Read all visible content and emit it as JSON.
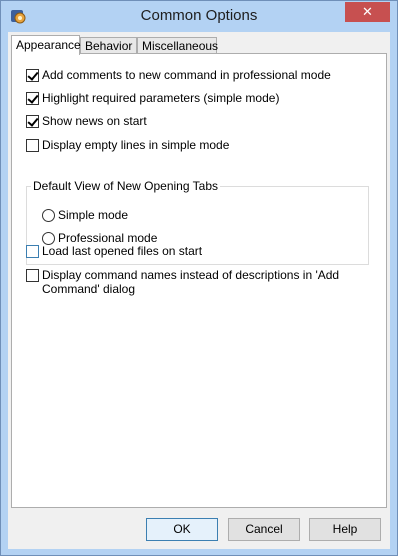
{
  "window": {
    "title": "Common Options",
    "close_glyph": "✕"
  },
  "tabs": [
    {
      "label": "Appearance",
      "active": true
    },
    {
      "label": "Behavior",
      "active": false
    },
    {
      "label": "Miscellaneous",
      "active": false
    }
  ],
  "options": {
    "add_comments": {
      "label": "Add comments to new command in professional mode",
      "checked": true
    },
    "highlight_required": {
      "label": "Highlight required parameters (simple mode)",
      "checked": true
    },
    "show_news": {
      "label": "Show news on start",
      "checked": true
    },
    "display_empty_lines": {
      "label": "Display empty lines in simple mode",
      "checked": false
    },
    "load_last_files": {
      "label": "Load last opened files on start",
      "checked": false
    },
    "display_command_names": {
      "label": "Display command names instead of descriptions in 'Add Command' dialog",
      "checked": false
    }
  },
  "default_view": {
    "label": "Default View of  New Opening Tabs",
    "options": [
      "Simple mode",
      "Professional mode"
    ],
    "selected": null
  },
  "buttons": {
    "ok": "OK",
    "cancel": "Cancel",
    "help": "Help"
  },
  "icons": {
    "app": "app-icon",
    "close": "close-icon"
  },
  "colors": {
    "close_button": "#c75050",
    "title_bar": "#b3d2f3",
    "default_button_border": "#3c7fb1"
  }
}
